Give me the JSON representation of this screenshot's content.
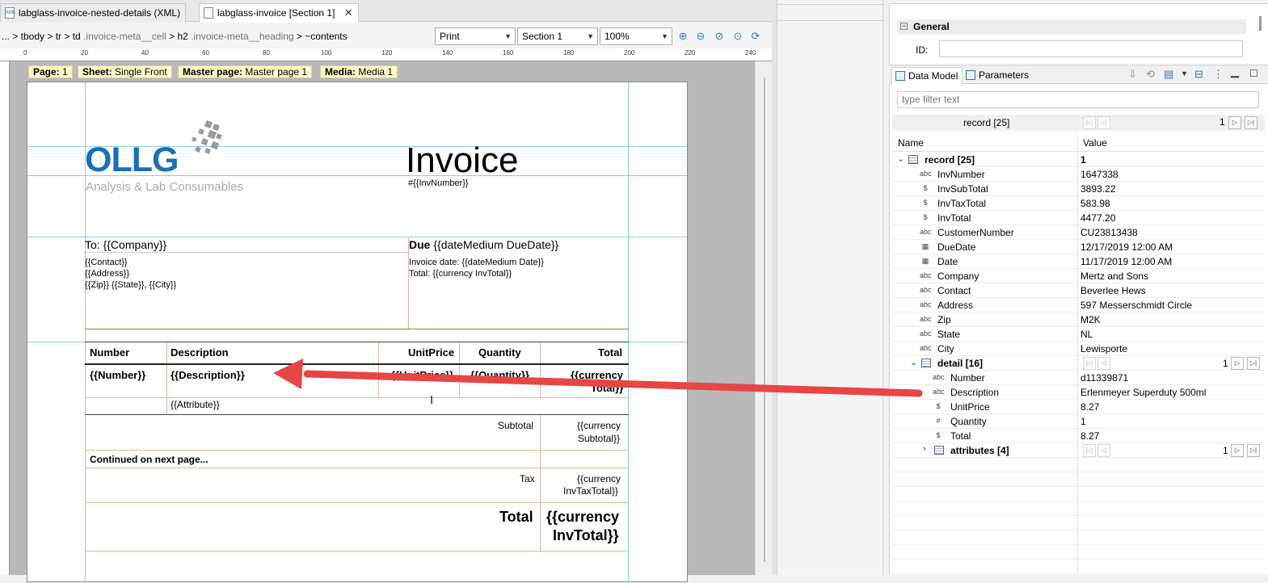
{
  "tabs": [
    {
      "label": "labglass-invoice-nested-details (XML)",
      "icon": "xml-file-icon"
    },
    {
      "label": "labglass-invoice [Section 1]",
      "icon": "template-file-icon",
      "close": "✕"
    }
  ],
  "breadcrumb": {
    "prefix": "... > tbody > tr > td",
    "cls1": ".invoice-meta__cell",
    "mid": " > h2",
    "cls2": ".invoice-meta__heading",
    "suffix": " > ~contents"
  },
  "toolbar": {
    "output": "Print",
    "section": "Section 1",
    "zoom": "100%"
  },
  "ruler": [
    "0",
    "20",
    "40",
    "60",
    "80",
    "100",
    "120",
    "140",
    "160",
    "180",
    "200",
    "220",
    "240"
  ],
  "page_info": [
    {
      "key": "Page:",
      "val": "1"
    },
    {
      "key": "Sheet:",
      "val": "Single Front"
    },
    {
      "key": "Master page:",
      "val": "Master page 1"
    },
    {
      "key": "Media:",
      "val": "Media 1"
    }
  ],
  "invoice": {
    "logo": "OLLG",
    "logo_sub": "Analysis & Lab Consumables",
    "title": "Invoice",
    "inv_number": "#{{InvNumber}}",
    "to": "To: {{Company}}",
    "contact": "{{Contact}}",
    "address": "{{Address}}",
    "zipline": "{{Zip}} {{State}}, {{City}}",
    "due_bold": "Due",
    "due_rest": "{{dateMedium DueDate}}",
    "invoice_date": "Invoice date: {{dateMedium Date}}",
    "total_line": "Total: {{currency InvTotal}}",
    "headers": {
      "number": "Number",
      "description": "Description",
      "unitprice": "UnitPrice",
      "quantity": "Quantity",
      "total": "Total"
    },
    "row": {
      "number": "{{Number}}",
      "description": "{{Description}}",
      "unitprice": "{{UnitPrice}}",
      "quantity": "{{Quantity}}",
      "total1": "{{currency",
      "total2": "Total}}"
    },
    "attribute": "{{Attribute}}",
    "subtotal_label": "Subtotal",
    "subtotal_val1": "{{currency",
    "subtotal_val2": "Subtotal}}",
    "continued": "Continued on next page...",
    "tax_label": "Tax",
    "tax_val1": "{{currency",
    "tax_val2": "InvTaxTotal}}",
    "grand_label": "Total",
    "grand_val1": "{{currency",
    "grand_val2": "InvTotal}}"
  },
  "properties": {
    "section": "General",
    "id_label": "ID:"
  },
  "panel_tabs": {
    "data_model": "Data Model",
    "parameters": "Parameters"
  },
  "filter_placeholder": "type filter text",
  "record_bar": {
    "label": "record [25]",
    "index": "1"
  },
  "grid_headers": {
    "name": "Name",
    "value": "Value"
  },
  "tree": [
    {
      "type": "table",
      "name": "record [25]",
      "value": "1",
      "level": 0,
      "expanded": true
    },
    {
      "type": "abc",
      "name": "InvNumber",
      "value": "1647338",
      "level": 1
    },
    {
      "type": "$",
      "name": "InvSubTotal",
      "value": "3893.22",
      "level": 1
    },
    {
      "type": "$",
      "name": "InvTaxTotal",
      "value": "583.98",
      "level": 1
    },
    {
      "type": "$",
      "name": "InvTotal",
      "value": "4477.20",
      "level": 1
    },
    {
      "type": "abc",
      "name": "CustomerNumber",
      "value": "CU23813438",
      "level": 1
    },
    {
      "type": "cal",
      "name": "DueDate",
      "value": "12/17/2019 12:00 AM",
      "level": 1
    },
    {
      "type": "cal",
      "name": "Date",
      "value": "11/17/2019 12:00 AM",
      "level": 1
    },
    {
      "type": "abc",
      "name": "Company",
      "value": "Mertz and Sons",
      "level": 1
    },
    {
      "type": "abc",
      "name": "Contact",
      "value": "Beverlee Hews",
      "level": 1
    },
    {
      "type": "abc",
      "name": "Address",
      "value": "597 Messerschmidt Circle",
      "level": 1
    },
    {
      "type": "abc",
      "name": "Zip",
      "value": "M2K",
      "level": 1
    },
    {
      "type": "abc",
      "name": "State",
      "value": "NL",
      "level": 1
    },
    {
      "type": "abc",
      "name": "City",
      "value": "Lewisporte",
      "level": 1
    },
    {
      "type": "table",
      "name": "detail [16]",
      "value": "1",
      "level": 1,
      "expanded": true
    },
    {
      "type": "abc",
      "name": "Number",
      "value": "d11339871",
      "level": 2
    },
    {
      "type": "abc",
      "name": "Description",
      "value": "Erlenmeyer Superduty 500ml",
      "level": 2
    },
    {
      "type": "$",
      "name": "UnitPrice",
      "value": "8.27",
      "level": 2
    },
    {
      "type": "#",
      "name": "Quantity",
      "value": "1",
      "level": 2
    },
    {
      "type": "$",
      "name": "Total",
      "value": "8.27",
      "level": 2
    },
    {
      "type": "table",
      "name": "attributes [4]",
      "value": "1",
      "level": 2,
      "expanded": false
    }
  ],
  "colors": {
    "accent_arrow": "#e84545",
    "logo_blue": "#1b6fb6",
    "guide_cyan": "#7fd4dd",
    "cell_orange": "#e8b48e"
  }
}
